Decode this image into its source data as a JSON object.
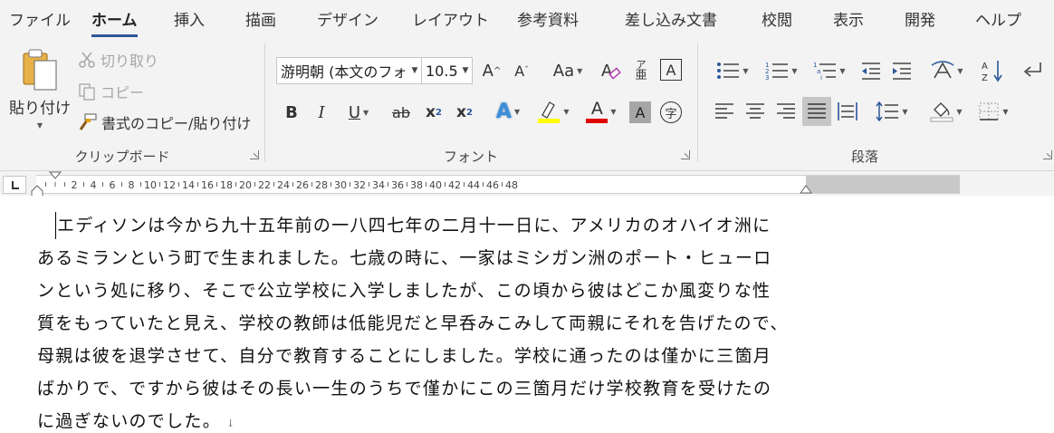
{
  "tabs": [
    {
      "label": "ファイル",
      "active": false
    },
    {
      "label": "ホーム",
      "active": true
    },
    {
      "label": "挿入",
      "active": false
    },
    {
      "label": "描画",
      "active": false
    },
    {
      "label": "デザイン",
      "active": false
    },
    {
      "label": "レイアウト",
      "active": false
    },
    {
      "label": "参考資料",
      "active": false
    },
    {
      "label": "差し込み文書",
      "active": false
    },
    {
      "label": "校閲",
      "active": false
    },
    {
      "label": "表示",
      "active": false
    },
    {
      "label": "開発",
      "active": false
    },
    {
      "label": "ヘルプ",
      "active": false
    }
  ],
  "clipboard": {
    "group_label": "クリップボード",
    "paste": "貼り付け",
    "cut": "切り取り",
    "copy": "コピー",
    "format_painter": "書式のコピー/貼り付け"
  },
  "font": {
    "group_label": "フォント",
    "font_name": "游明朝 (本文のフォ",
    "font_size": "10.5",
    "grow": "A",
    "shrink": "A",
    "change_case": "Aa",
    "phonetic_top": "ア",
    "phonetic_bottom": "亜",
    "char_border": "A",
    "bold": "B",
    "italic": "I",
    "underline": "U",
    "strike": "ab",
    "subscript": "x",
    "superscript": "x",
    "text_effects": "A",
    "font_color": "A",
    "char_shading": "A",
    "enclose": "字",
    "highlight_color": "#ffff00",
    "font_color_value": "#e00000"
  },
  "paragraph": {
    "group_label": "段落"
  },
  "ruler": {
    "labels": [
      "2",
      "4",
      "6",
      "8",
      "10",
      "12",
      "14",
      "16",
      "18",
      "20",
      "22",
      "24",
      "26",
      "28",
      "30",
      "32",
      "34",
      "36",
      "38",
      "40",
      "42",
      "44",
      "46",
      "48"
    ]
  },
  "document": {
    "lines": [
      "エディソンは今から九十五年前の一八四七年の二月十一日に、アメリカのオハイオ洲に",
      "あるミランという町で生まれました。七歳の時に、一家はミシガン洲のポート・ヒューロ",
      "ンという処に移り、そこで公立学校に入学しましたが、この頃から彼はどこか風変りな性",
      "質をもっていたと見え、学校の教師は低能児だと早呑みこみして両親にそれを告げたので、",
      "母親は彼を退学させて、自分で教育することにしました。学校に通ったのは僅かに三箇月",
      "ばかりで、ですから彼はその長い一生のうちで僅かにこの三箇月だけ学校教育を受けたの",
      "に過ぎないのでした。"
    ],
    "paragraph_mark": "↓"
  }
}
